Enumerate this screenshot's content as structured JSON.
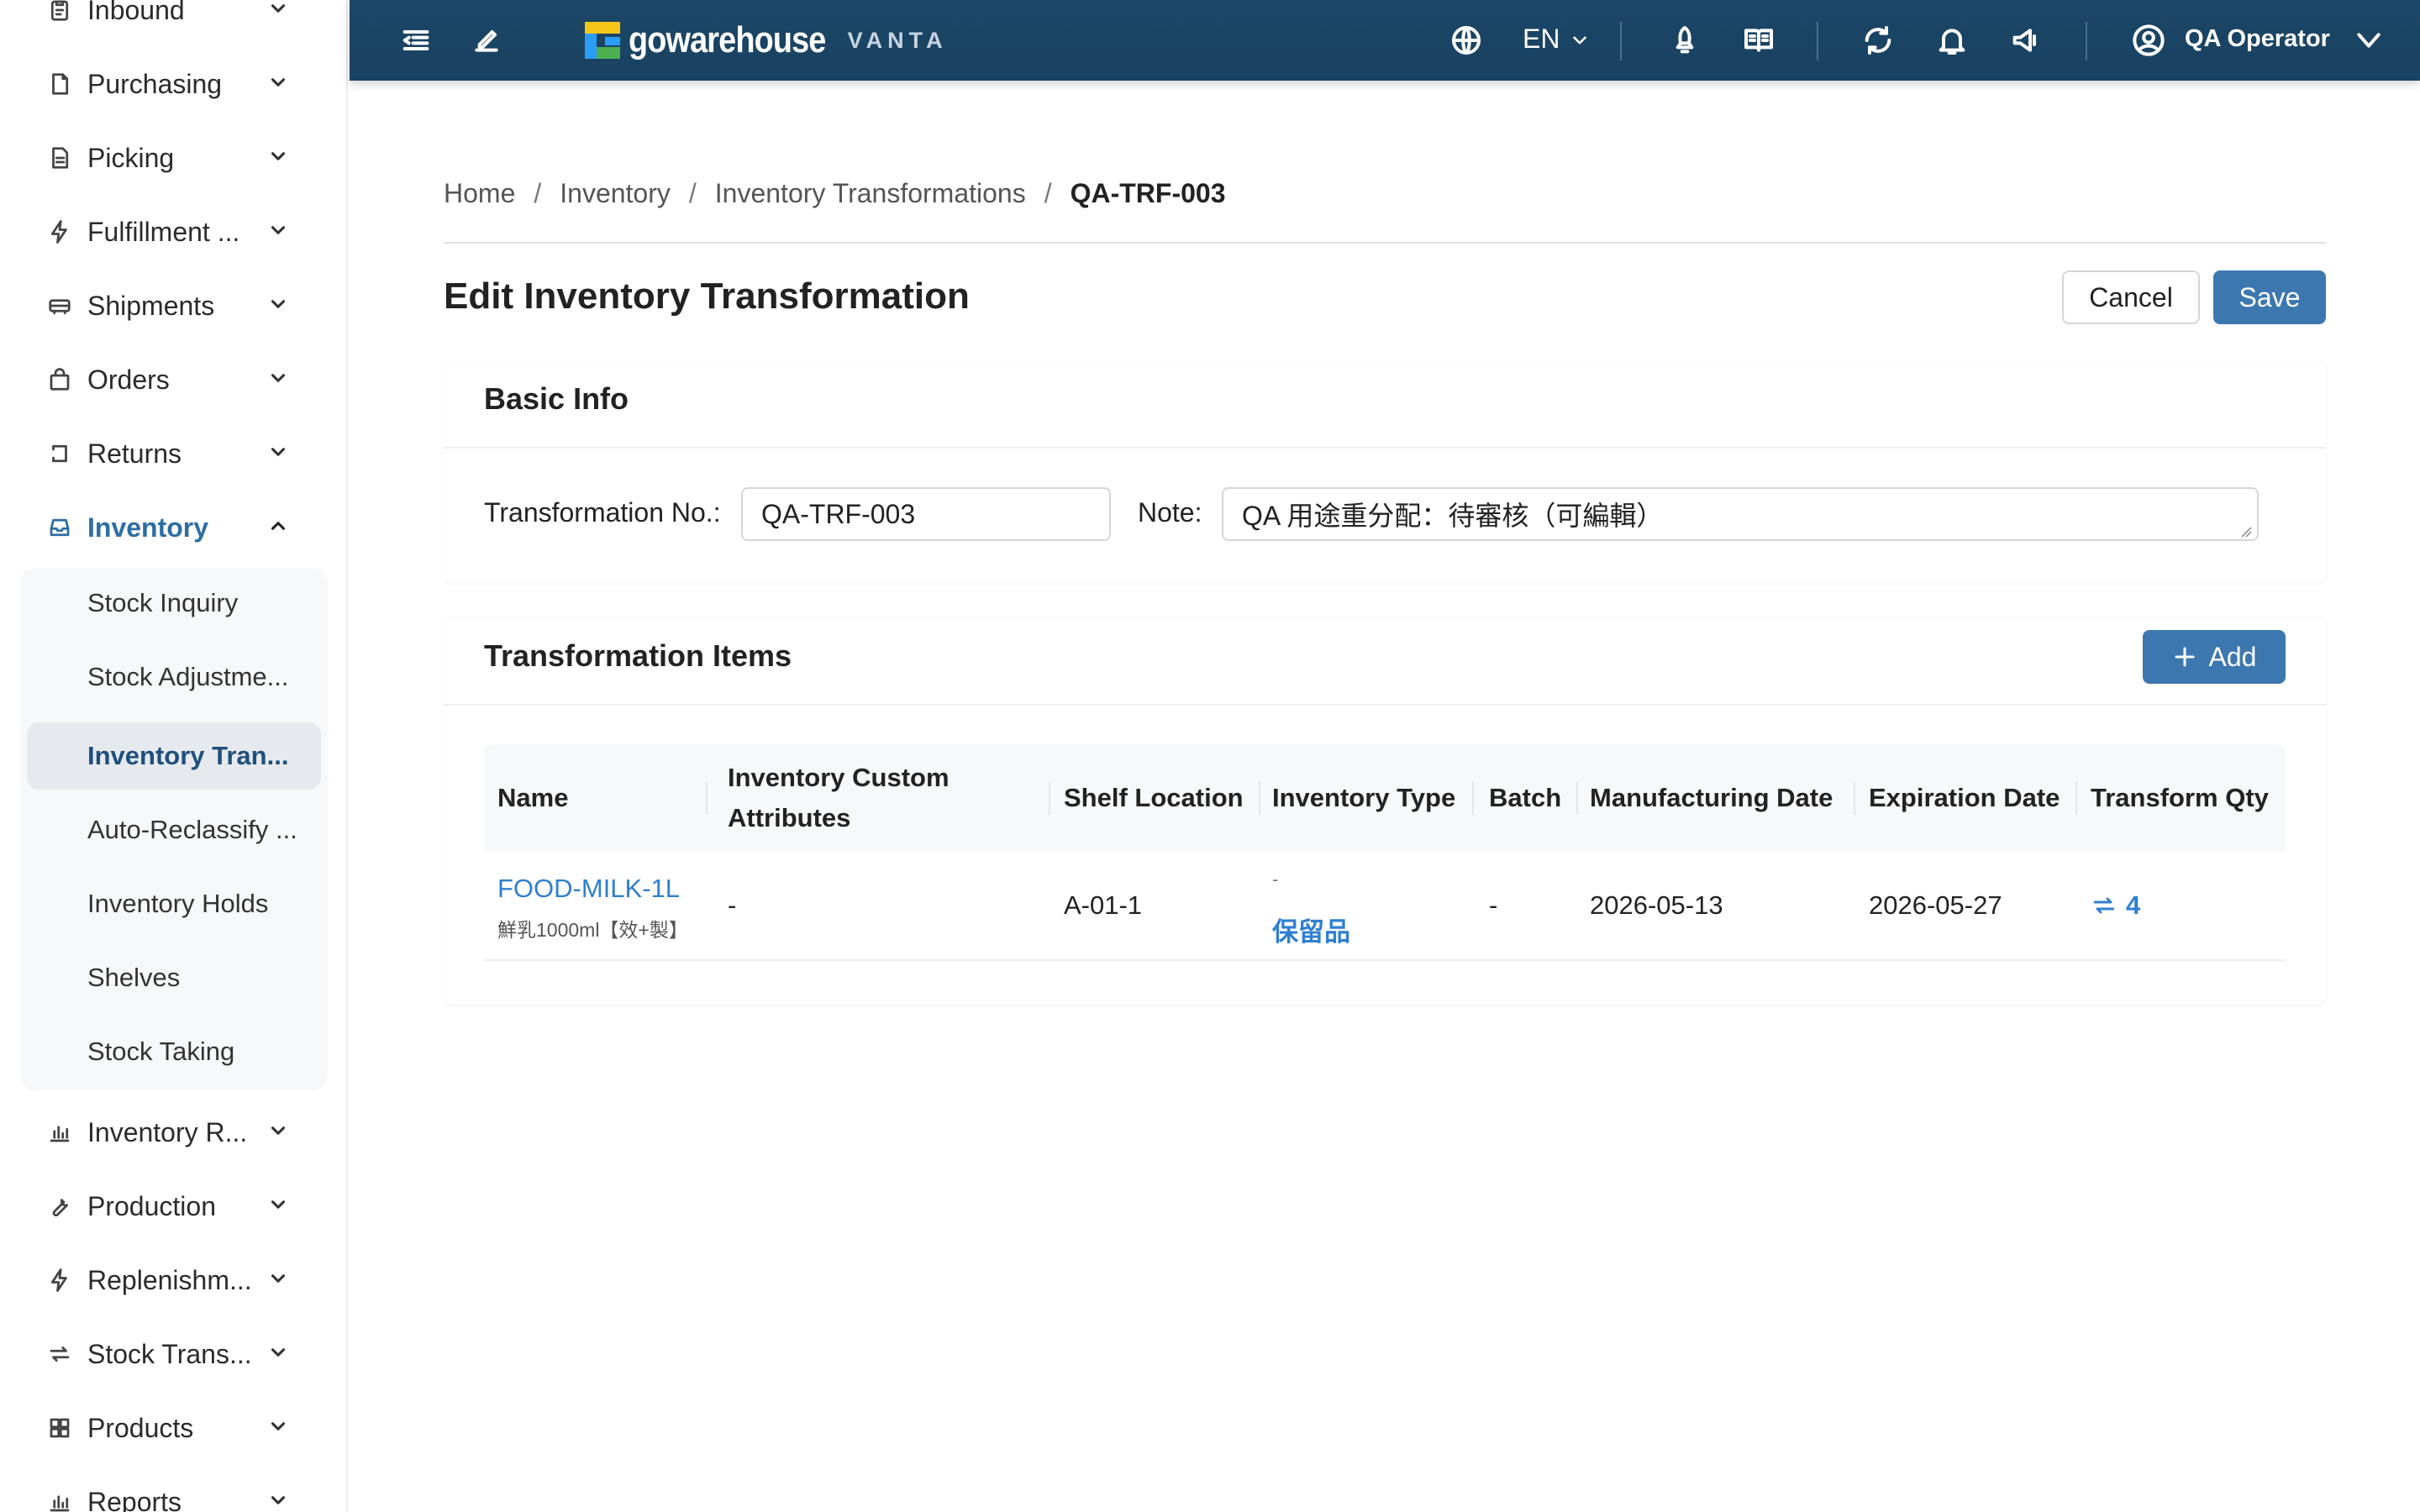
{
  "sidebar": {
    "items": [
      {
        "label": "Inbound",
        "icon": "clipboard-icon"
      },
      {
        "label": "Purchasing",
        "icon": "document-icon"
      },
      {
        "label": "Picking",
        "icon": "file-list-icon"
      },
      {
        "label": "Fulfillment ...",
        "icon": "lightning-icon"
      },
      {
        "label": "Shipments",
        "icon": "truck-icon"
      },
      {
        "label": "Orders",
        "icon": "bag-icon"
      },
      {
        "label": "Returns",
        "icon": "return-icon"
      },
      {
        "label": "Inventory",
        "icon": "inbox-icon"
      },
      {
        "label": "Inventory R...",
        "icon": "bar-chart-icon"
      },
      {
        "label": "Production",
        "icon": "wrench-icon"
      },
      {
        "label": "Replenishm...",
        "icon": "lightning-icon"
      },
      {
        "label": "Stock Trans...",
        "icon": "transfer-icon"
      },
      {
        "label": "Products",
        "icon": "grid-icon"
      },
      {
        "label": "Reports",
        "icon": "bar-chart-icon"
      }
    ],
    "inventory_sub": [
      "Stock Inquiry",
      "Stock Adjustme...",
      "Inventory Tran...",
      "Auto-Reclassify ...",
      "Inventory Holds",
      "Shelves",
      "Stock Taking"
    ]
  },
  "header": {
    "brand": "gowarehouse",
    "brand_sub": "VANTA",
    "language": "EN",
    "user": "QA Operator",
    "logo_colors": [
      "#f5c518",
      "#2a9df4",
      "#4caf50"
    ]
  },
  "breadcrumb": [
    "Home",
    "Inventory",
    "Inventory Transformations",
    "QA-TRF-003"
  ],
  "page": {
    "title": "Edit Inventory Transformation",
    "cancel_label": "Cancel",
    "save_label": "Save"
  },
  "basic_info": {
    "title": "Basic Info",
    "transformation_no_label": "Transformation No.:",
    "transformation_no": "QA-TRF-003",
    "note_label": "Note:",
    "note": "QA 用途重分配：待審核（可編輯）"
  },
  "items": {
    "title": "Transformation Items",
    "add_label": "Add",
    "columns": {
      "name": "Name",
      "custom_attrs_1": "Inventory Custom",
      "custom_attrs_2": "Attributes",
      "shelf": "Shelf Location",
      "type": "Inventory Type",
      "batch": "Batch",
      "mfg": "Manufacturing Date",
      "exp": "Expiration Date",
      "qty": "Transform Qty"
    },
    "rows": [
      {
        "sku": "FOOD-MILK-1L",
        "desc": "鮮乳1000ml【效+製】",
        "custom_attrs": "-",
        "shelf": "A-01-1",
        "type_from": "-",
        "type_to": "保留品",
        "batch": "-",
        "mfg": "2026-05-13",
        "exp": "2026-05-27",
        "qty": "4"
      }
    ]
  }
}
